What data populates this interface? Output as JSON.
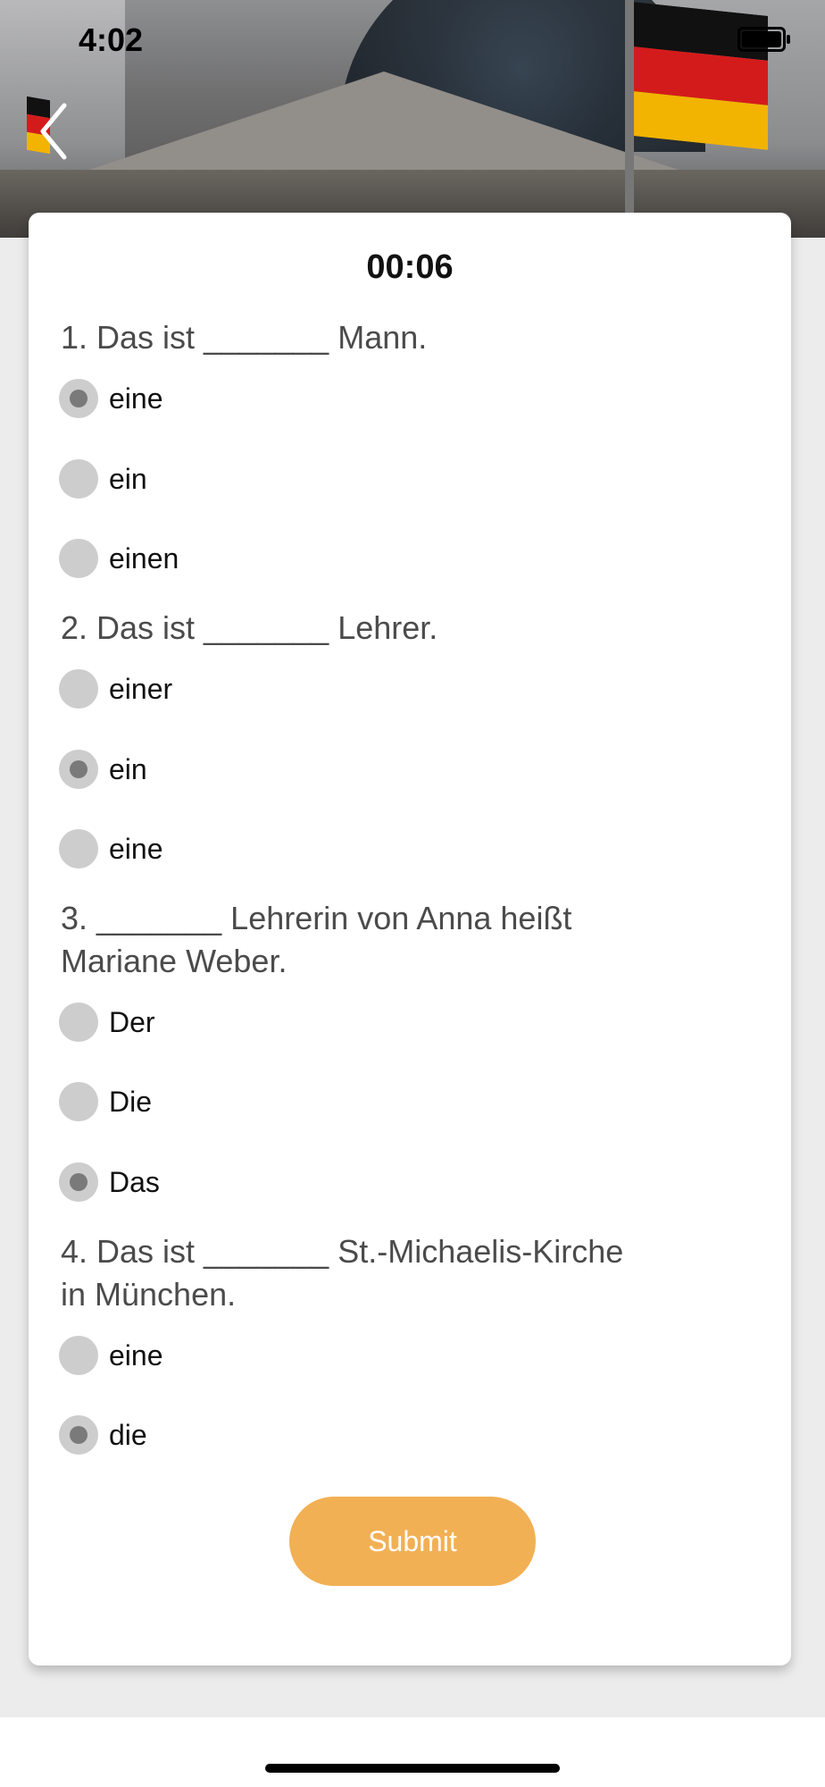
{
  "status_bar": {
    "time": "4:02"
  },
  "quiz": {
    "timer": "00:06",
    "questions": [
      {
        "text": "1. Das ist _______ Mann.",
        "options": [
          {
            "label": "eine",
            "selected": true
          },
          {
            "label": "ein",
            "selected": false
          },
          {
            "label": "einen",
            "selected": false
          }
        ]
      },
      {
        "text": "2. Das ist _______ Lehrer.",
        "options": [
          {
            "label": "einer",
            "selected": false
          },
          {
            "label": "ein",
            "selected": true
          },
          {
            "label": "eine",
            "selected": false
          }
        ]
      },
      {
        "text_line1": "3. _______ Lehrerin von Anna heißt",
        "text_line2": "Mariane Weber.",
        "options": [
          {
            "label": "Der",
            "selected": false
          },
          {
            "label": "Die",
            "selected": false
          },
          {
            "label": "Das",
            "selected": true
          }
        ]
      },
      {
        "text_line1": "4. Das ist _______ St.-Michaelis-Kirche",
        "text_line2": "in München.",
        "options": [
          {
            "label": "eine",
            "selected": false
          },
          {
            "label": "die",
            "selected": true
          }
        ]
      }
    ],
    "submit_label": "Submit"
  },
  "colors": {
    "accent": "#f2b054",
    "radio_bg": "#cdcdcd",
    "radio_dot": "#7a7a7a"
  }
}
